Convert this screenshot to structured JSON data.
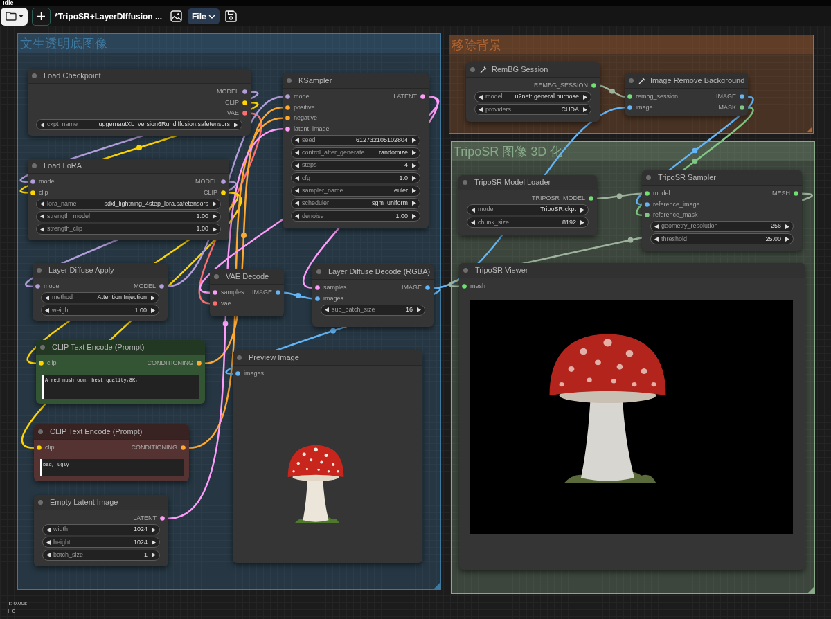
{
  "status": "Idle",
  "toolbar": {
    "title": "*TripoSR+LayerDIffusion ...",
    "menu": "File"
  },
  "groups": [
    {
      "title": "文生透明底图像",
      "color": "#3f789e"
    },
    {
      "title": "移除背景",
      "color": "#b06634"
    },
    {
      "title": "TripoSR 图像 3D 化",
      "color": "#88aa88"
    }
  ],
  "nodes": [
    {
      "kind": "basic",
      "title": "Load Checkpoint",
      "icon": false,
      "outputs": [
        {
          "label": "MODEL",
          "color": "#b39ddb"
        },
        {
          "label": "CLIP",
          "color": "#ffd500"
        },
        {
          "label": "VAE",
          "color": "#ff6e6e"
        }
      ],
      "widgets": [
        {
          "label": "ckpt_name",
          "value": "juggernautXL_version6Rundiffusion.safetensors"
        }
      ]
    },
    {
      "kind": "basic",
      "title": "Load LoRA",
      "icon": false,
      "inputs": [
        {
          "label": "model",
          "color": "#b39ddb"
        },
        {
          "label": "clip",
          "color": "#ffd500"
        }
      ],
      "outputs": [
        {
          "label": "MODEL",
          "color": "#b39ddb"
        },
        {
          "label": "CLIP",
          "color": "#ffd500"
        }
      ],
      "widgets": [
        {
          "label": "lora_name",
          "value": "sdxl_lightning_4step_lora.safetensors"
        },
        {
          "label": "strength_model",
          "value": "1.00"
        },
        {
          "label": "strength_clip",
          "value": "1.00"
        }
      ]
    },
    {
      "kind": "basic",
      "title": "Layer Diffuse Apply",
      "icon": false,
      "inputs": [
        {
          "label": "model",
          "color": "#b39ddb"
        }
      ],
      "outputs": [
        {
          "label": "MODEL",
          "color": "#b39ddb"
        }
      ],
      "widgets": [
        {
          "label": "method",
          "value": "Attention Injection"
        },
        {
          "label": "weight",
          "value": "1.00"
        }
      ]
    },
    {
      "kind": "prompt",
      "title": "CLIP Text Encode (Prompt)",
      "icon": false,
      "color": "#335533",
      "inputs": [
        {
          "label": "clip",
          "color": "#ffd500"
        }
      ],
      "outputs": [
        {
          "label": "CONDITIONING",
          "color": "#ffa931"
        }
      ],
      "text": "A red mushroom, best quality,8K,"
    },
    {
      "kind": "prompt",
      "title": "CLIP Text Encode (Prompt)",
      "icon": false,
      "color": "#553333",
      "inputs": [
        {
          "label": "clip",
          "color": "#ffd500"
        }
      ],
      "outputs": [
        {
          "label": "CONDITIONING",
          "color": "#ffa931"
        }
      ],
      "text": "bad, ugly"
    },
    {
      "kind": "basic",
      "title": "Empty Latent Image",
      "icon": false,
      "outputs": [
        {
          "label": "LATENT",
          "color": "#ff9cf9"
        }
      ],
      "widgets": [
        {
          "label": "width",
          "value": "1024"
        },
        {
          "label": "height",
          "value": "1024"
        },
        {
          "label": "batch_size",
          "value": "1"
        }
      ]
    },
    {
      "kind": "basic",
      "title": "KSampler",
      "icon": false,
      "inputs": [
        {
          "label": "model",
          "color": "#b39ddb"
        },
        {
          "label": "positive",
          "color": "#ffa931"
        },
        {
          "label": "negative",
          "color": "#ffa931"
        },
        {
          "label": "latent_image",
          "color": "#ff9cf9"
        }
      ],
      "outputs": [
        {
          "label": "LATENT",
          "color": "#ff9cf9"
        }
      ],
      "widgets": [
        {
          "label": "seed",
          "value": "612732105102804"
        },
        {
          "label": "control_after_generate",
          "value": "randomize"
        },
        {
          "label": "steps",
          "value": "4"
        },
        {
          "label": "cfg",
          "value": "1.0"
        },
        {
          "label": "sampler_name",
          "value": "euler"
        },
        {
          "label": "scheduler",
          "value": "sgm_uniform"
        },
        {
          "label": "denoise",
          "value": "1.00"
        }
      ]
    },
    {
      "kind": "basic",
      "title": "VAE Decode",
      "icon": false,
      "inputs": [
        {
          "label": "samples",
          "color": "#ff9cf9"
        },
        {
          "label": "vae",
          "color": "#ff6e6e"
        }
      ],
      "outputs": [
        {
          "label": "IMAGE",
          "color": "#64b5f6"
        }
      ]
    },
    {
      "kind": "basic",
      "title": "Layer Diffuse Decode (RGBA)",
      "icon": false,
      "inputs": [
        {
          "label": "samples",
          "color": "#ff9cf9"
        },
        {
          "label": "images",
          "color": "#64b5f6"
        }
      ],
      "outputs": [
        {
          "label": "IMAGE",
          "color": "#64b5f6"
        }
      ],
      "widgets": [
        {
          "label": "sub_batch_size",
          "value": "16"
        }
      ]
    },
    {
      "kind": "image_preview",
      "title": "Preview Image",
      "icon": false,
      "inputs": [
        {
          "label": "images",
          "color": "#64b5f6"
        }
      ]
    },
    {
      "kind": "basic",
      "title": "RemBG Session",
      "icon": true,
      "outputs": [
        {
          "label": "REMBG_SESSION",
          "color": "#70e070"
        }
      ],
      "widgets": [
        {
          "label": "model",
          "value": "u2net: general purpose"
        },
        {
          "label": "providers",
          "value": "CUDA"
        }
      ]
    },
    {
      "kind": "basic",
      "title": "Image Remove Background",
      "icon": true,
      "inputs": [
        {
          "label": "rembg_session",
          "color": "#70e070"
        },
        {
          "label": "image",
          "color": "#64b5f6"
        }
      ],
      "outputs": [
        {
          "label": "IMAGE",
          "color": "#64b5f6"
        },
        {
          "label": "MASK",
          "color": "#81c784"
        }
      ]
    },
    {
      "kind": "basic",
      "title": "TripoSR Model Loader",
      "icon": false,
      "outputs": [
        {
          "label": "TRIPOSR_MODEL",
          "color": "#70e070"
        }
      ],
      "widgets": [
        {
          "label": "model",
          "value": "TripoSR.ckpt"
        },
        {
          "label": "chunk_size",
          "value": "8192"
        }
      ]
    },
    {
      "kind": "basic",
      "title": "TripoSR Sampler",
      "icon": false,
      "inputs": [
        {
          "label": "model",
          "color": "#70e070"
        },
        {
          "label": "reference_image",
          "color": "#64b5f6"
        },
        {
          "label": "reference_mask",
          "color": "#81c784"
        }
      ],
      "outputs": [
        {
          "label": "MESH",
          "color": "#70e070"
        }
      ],
      "widgets": [
        {
          "label": "geometry_resolution",
          "value": "256"
        },
        {
          "label": "threshold",
          "value": "25.00"
        }
      ]
    },
    {
      "kind": "mesh_viewer",
      "title": "TripoSR Viewer",
      "icon": false,
      "inputs": [
        {
          "label": "mesh",
          "color": "#70e070"
        }
      ]
    }
  ],
  "stats": [
    "T: 0.00s",
    "I: 0"
  ]
}
